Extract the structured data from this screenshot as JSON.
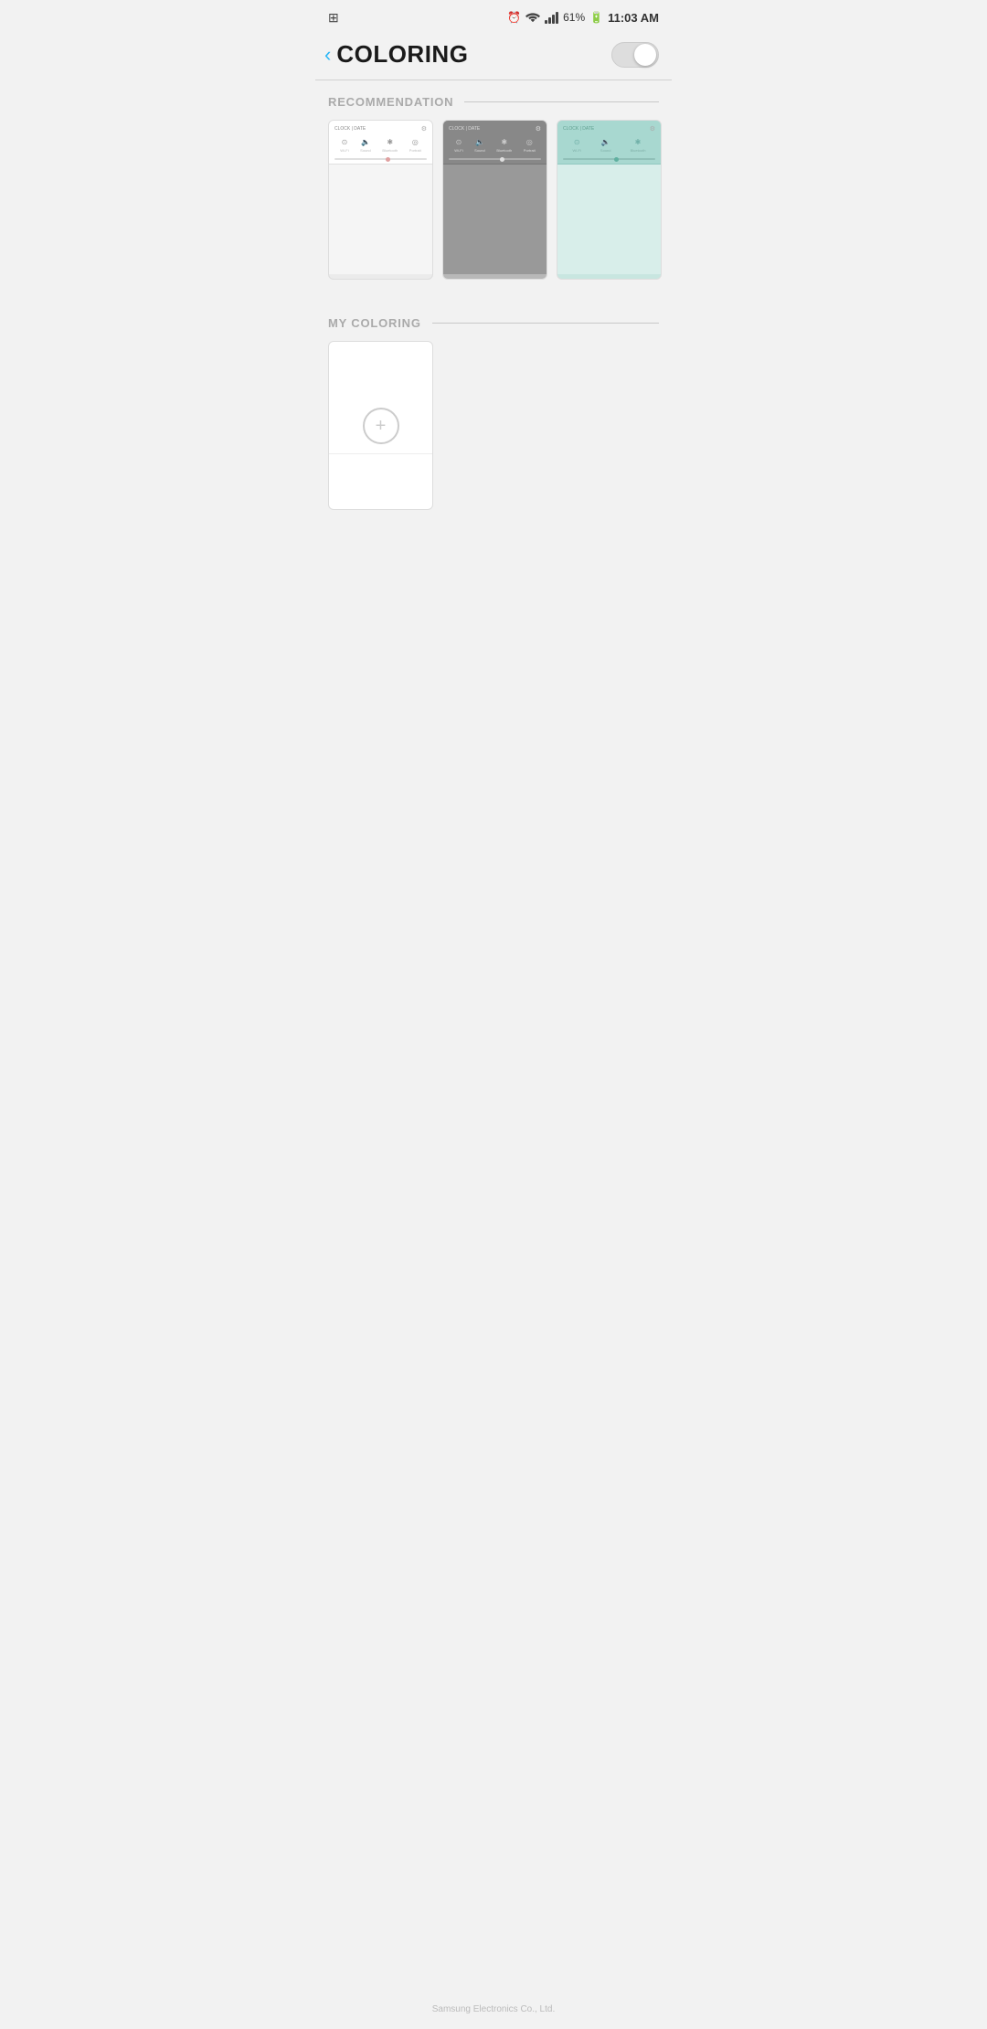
{
  "statusBar": {
    "time": "11:03 AM",
    "battery": "61%",
    "batteryIcon": "🔋",
    "alarm": "⏰",
    "wifi": "wifi-icon",
    "signal": "signal-icon"
  },
  "header": {
    "title": "COLORING",
    "backLabel": "‹",
    "toggleState": "off"
  },
  "recommendation": {
    "sectionTitle": "RECOMMENDATION",
    "cards": [
      {
        "id": "card-1",
        "theme": "light",
        "clockText": "CLOCK | DATE",
        "icons": [
          "wifi",
          "sound",
          "bluetooth",
          "portrait"
        ],
        "labels": [
          "Wi-Fi",
          "Sound",
          "Bluetooth",
          "Portrait"
        ]
      },
      {
        "id": "card-2",
        "theme": "dark",
        "clockText": "CLOCK | DATE",
        "icons": [
          "wifi",
          "sound",
          "bluetooth",
          "portrait"
        ],
        "labels": [
          "Wi-Fi",
          "Sound",
          "Bluetooth",
          "Portrait"
        ]
      },
      {
        "id": "card-3",
        "theme": "teal",
        "clockText": "CLOCK | DATE",
        "icons": [
          "wifi",
          "sound",
          "bluetooth"
        ],
        "labels": [
          "Wi-Fi",
          "Sound",
          "Bluetooth"
        ]
      }
    ]
  },
  "myColoring": {
    "sectionTitle": "MY COLORING",
    "addButton": "+"
  },
  "bottomText": "Samsung Electronics Co., Ltd."
}
